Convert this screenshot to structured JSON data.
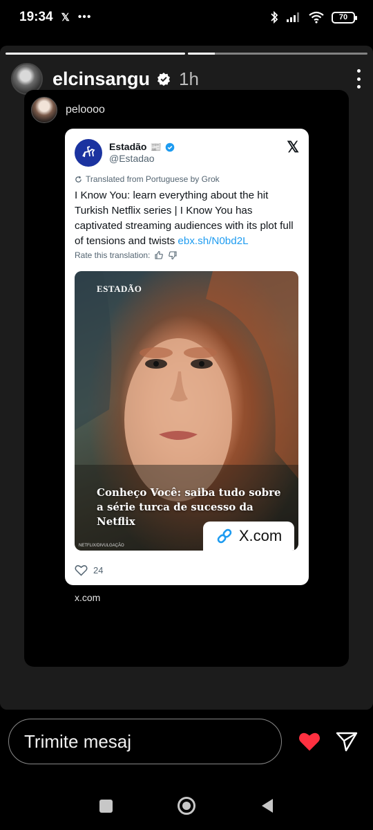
{
  "status_bar": {
    "time": "19:34",
    "notification_icons": [
      "x-logo",
      "more-dots"
    ],
    "battery": "70"
  },
  "story": {
    "progress_fraction": [
      1.0,
      0.15
    ],
    "username": "elcinsangu",
    "time_ago": "1h"
  },
  "repost": {
    "username": "peloooo",
    "source_label": "x.com"
  },
  "tweet": {
    "display_name": "Estadão",
    "handle": "@Estadao",
    "translated_note": "Translated from Portuguese by Grok",
    "text": "I Know You: learn everything about the hit Turkish Netflix series | I Know You has captivated streaming audiences with its plot full of tensions and twists ",
    "link": "ebx.sh/N0bd2L",
    "rate_translation": "Rate this translation:",
    "image": {
      "brand": "ESTADÃO",
      "caption": "Conheço Você: saiba tudo sobre a série turca de sucesso da Netflix",
      "credit": "NETFLIX/DIVULGAÇÃO",
      "badge": "X.com"
    },
    "likes": "24"
  },
  "reply_bar": {
    "placeholder": "Trimite mesaj"
  },
  "colors": {
    "like_red": "#ff3040",
    "link_blue": "#1d9bf0",
    "verified_blue": "#1d9bf0"
  }
}
